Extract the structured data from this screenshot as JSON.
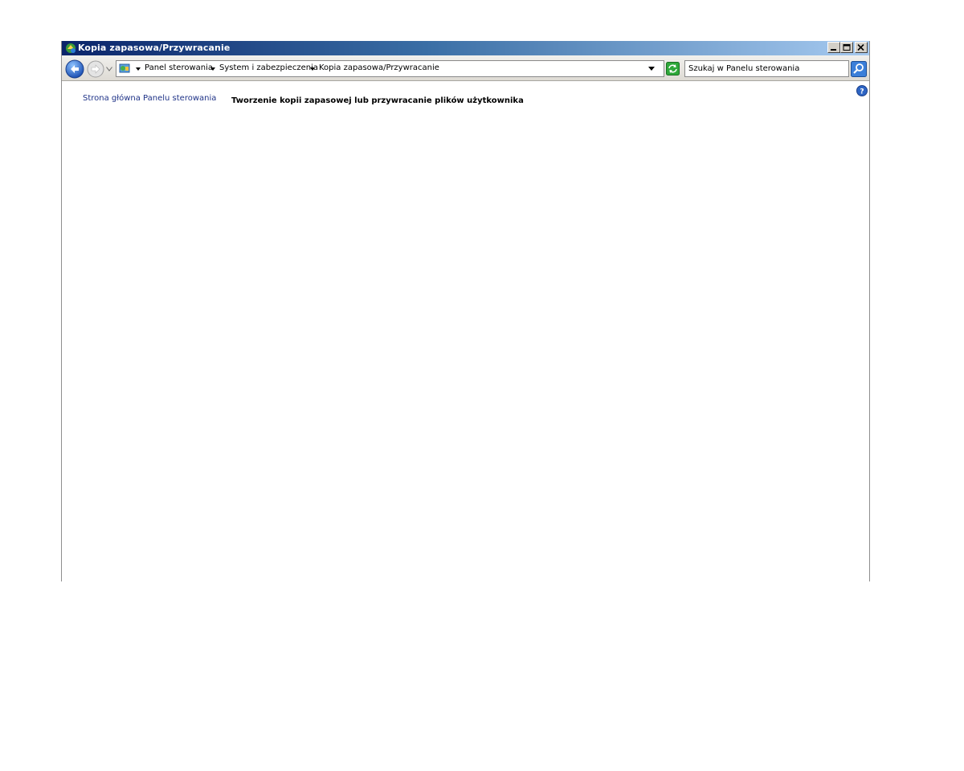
{
  "window": {
    "title": "Kopia zapasowa/Przywracanie",
    "caption_buttons": [
      "minimize",
      "maximize",
      "close"
    ]
  },
  "addressbar": {
    "breadcrumb": [
      "Panel sterowania",
      "System i zabezpieczenia",
      "Kopia zapasowa/Przywracanie"
    ],
    "search_placeholder": "Szukaj w Panelu sterowania",
    "search_value": "Szukaj w Panelu sterowania"
  },
  "sidebar": {
    "home_link": "Strona główna Panelu sterowania"
  },
  "main": {
    "heading": "Tworzenie kopii zapasowej lub przywracanie plików użytkownika"
  },
  "colors": {
    "title_gradient_start": "#0a246a",
    "title_gradient_end": "#a6caf0",
    "link": "#1e3287"
  }
}
